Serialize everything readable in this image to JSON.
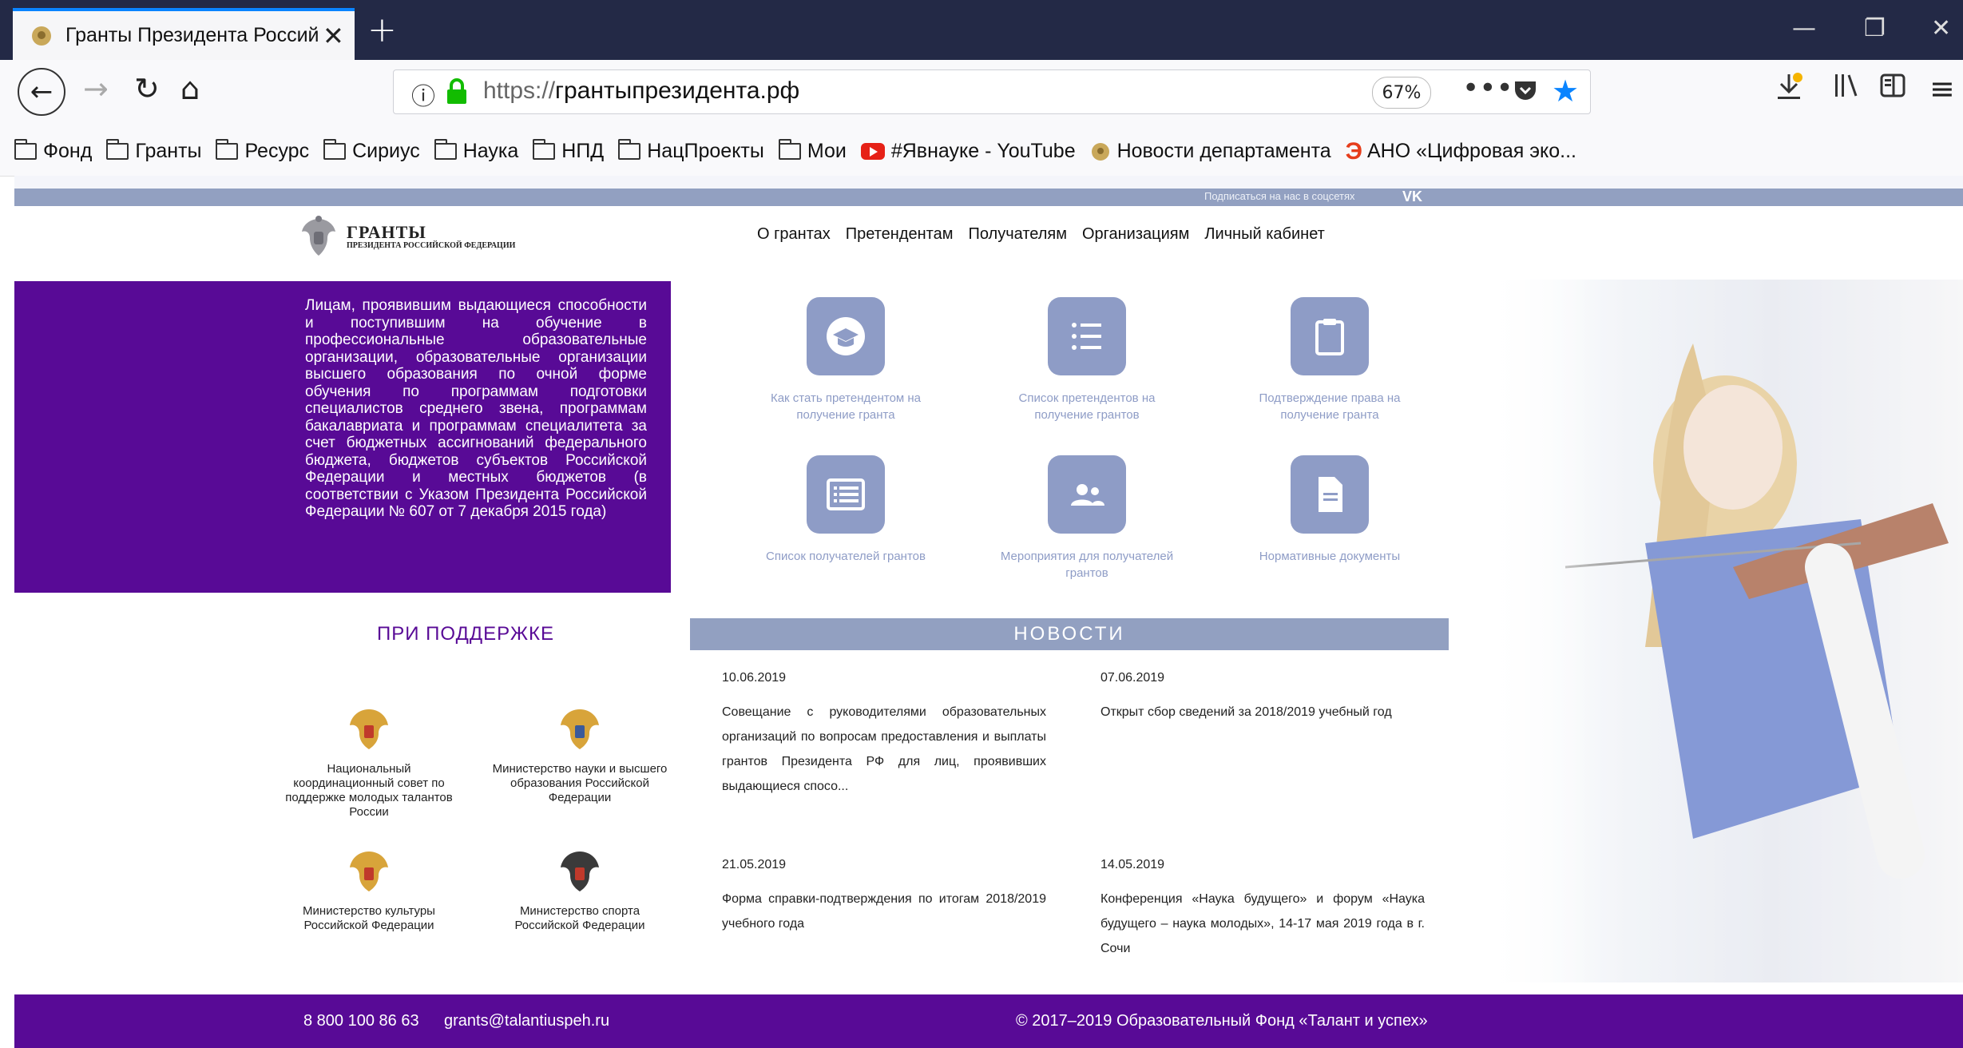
{
  "browser": {
    "tab_title": "Гранты Президента Российск",
    "tab_close": "✕",
    "new_tab": "+",
    "window_minimize": "—",
    "window_restore": "❐",
    "window_close": "✕",
    "url_protocol": "https://",
    "url_host": "грантыпрезидента.рф",
    "zoom": "67%",
    "bookmarks": [
      {
        "label": "Фонд",
        "icon": "folder-icon"
      },
      {
        "label": "Гранты",
        "icon": "folder-icon"
      },
      {
        "label": "Ресурс",
        "icon": "folder-icon"
      },
      {
        "label": "Сириус",
        "icon": "folder-icon"
      },
      {
        "label": "Наука",
        "icon": "folder-icon"
      },
      {
        "label": "НПД",
        "icon": "folder-icon"
      },
      {
        "label": "НацПроекты",
        "icon": "folder-icon"
      },
      {
        "label": "Мои",
        "icon": "folder-icon"
      },
      {
        "label": "#Явнауке - YouTube",
        "icon": "youtube-icon"
      },
      {
        "label": "Новости департамента",
        "icon": "emblem-icon"
      },
      {
        "label": "АНО «Цифровая эко...",
        "icon": "ek-icon"
      }
    ],
    "ek_glyph": "Э"
  },
  "site": {
    "social_text": "Подписаться на нас в соцсетях",
    "vk": "VK",
    "logo_title": "ГРАНТЫ",
    "logo_subtitle": "ПРЕЗИДЕНТА РОССИЙСКОЙ ФЕДЕРАЦИИ",
    "nav": [
      "О грантах",
      "Претендентам",
      "Получателям",
      "Организациям",
      "Личный кабинет"
    ],
    "promo_text": "Лицам, проявившим выдающиеся способности и поступившим на обучение в профессиональные образовательные организации, образовательные организации высшего образования по очной форме обучения по программам подготовки специалистов среднего звена, программам бакалавриата и программам специалитета за счет бюджетных ассигнований федерального бюджета, бюджетов субъектов Российской Федерации и местных бюджетов (в соответствии с Указом Президента Российской Федерации № 607 от 7 декабря 2015 года)",
    "tiles": [
      {
        "label": "Как стать претендентом на получение гранта",
        "icon": "graduation-cap-icon"
      },
      {
        "label": "Список претендентов на получение грантов",
        "icon": "list-icon"
      },
      {
        "label": "Подтверждение права на получение гранта",
        "icon": "clipboard-icon"
      },
      {
        "label": "Список получателей грантов",
        "icon": "list-box-icon"
      },
      {
        "label": "Мероприятия для получателей грантов",
        "icon": "people-icon"
      },
      {
        "label": "Нормативные документы",
        "icon": "document-icon"
      }
    ],
    "support_title": "ПРИ ПОДДЕРЖКЕ",
    "orgs": [
      {
        "label": "Национальный координационный совет по поддержке молодых талантов России"
      },
      {
        "label": "Министерство науки и высшего образования Российской Федерации"
      },
      {
        "label": "Министерство культуры Российской Федерации"
      },
      {
        "label": "Министерство спорта Российской Федерации"
      }
    ],
    "news_title": "НОВОСТИ",
    "news": [
      {
        "date": "10.06.2019",
        "text": "Совещание с руководителями образовательных организаций по вопросам предоставления и выплаты грантов Президента РФ для лиц, проявивших выдающиеся спосо..."
      },
      {
        "date": "07.06.2019",
        "text": "Открыт сбор сведений за 2018/2019 учебный год"
      },
      {
        "date": "21.05.2019",
        "text": "Форма справки-подтверждения по итогам 2018/2019 учебного года"
      },
      {
        "date": "14.05.2019",
        "text": "Конференция «Наука будущего» и форум «Наука будущего – наука молодых», 14-17 мая 2019 года в г. Сочи"
      }
    ],
    "footer_phone": "8 800 100 86 63",
    "footer_email": "grants@talantiuspeh.ru",
    "footer_copy": "© 2017–2019 Образовательный Фонд «Талант и успех»"
  },
  "colors": {
    "brand_purple": "#580a96",
    "accent_blue": "#8e9cc6",
    "strip_blue": "#92a0c1",
    "tab_accent": "#0a84ff"
  }
}
